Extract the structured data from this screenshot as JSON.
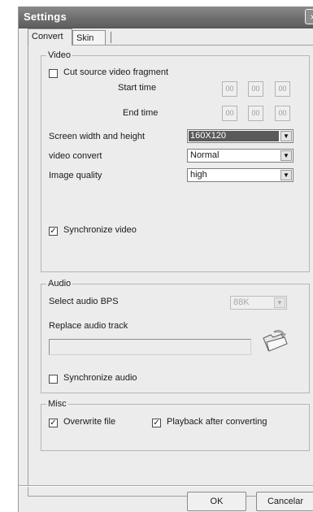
{
  "window": {
    "title": "Settings",
    "close_glyph": "×"
  },
  "tabs": [
    {
      "label": "Convert",
      "active": true
    },
    {
      "label": "Skin",
      "active": false
    }
  ],
  "video": {
    "legend": "Video",
    "cut_label": "Cut source video fragment",
    "cut_checked": false,
    "start_time_label": "Start time",
    "end_time_label": "End time",
    "start_time": [
      "00",
      "00",
      "00"
    ],
    "end_time": [
      "00",
      "00",
      "00"
    ],
    "screen_label": "Screen width and height",
    "screen_value": "160X120",
    "convert_label": "video convert",
    "convert_value": "Normal",
    "quality_label": "Image quality",
    "quality_value": "high",
    "sync_label": "Synchronize video",
    "sync_checked": true
  },
  "audio": {
    "legend": "Audio",
    "bps_label": "Select audio BPS",
    "bps_value": "88K",
    "replace_label": "Replace audio track",
    "replace_value": "",
    "folder_icon": "open-folder-icon",
    "sync_label": "Synchronize audio",
    "sync_checked": false
  },
  "misc": {
    "legend": "Misc",
    "overwrite_label": "Overwrite file",
    "overwrite_checked": true,
    "playback_label": "Playback after converting",
    "playback_checked": true
  },
  "buttons": {
    "ok": "OK",
    "cancel": "Cancelar"
  },
  "icons": {
    "dropdown": "▼",
    "check": "✓"
  }
}
